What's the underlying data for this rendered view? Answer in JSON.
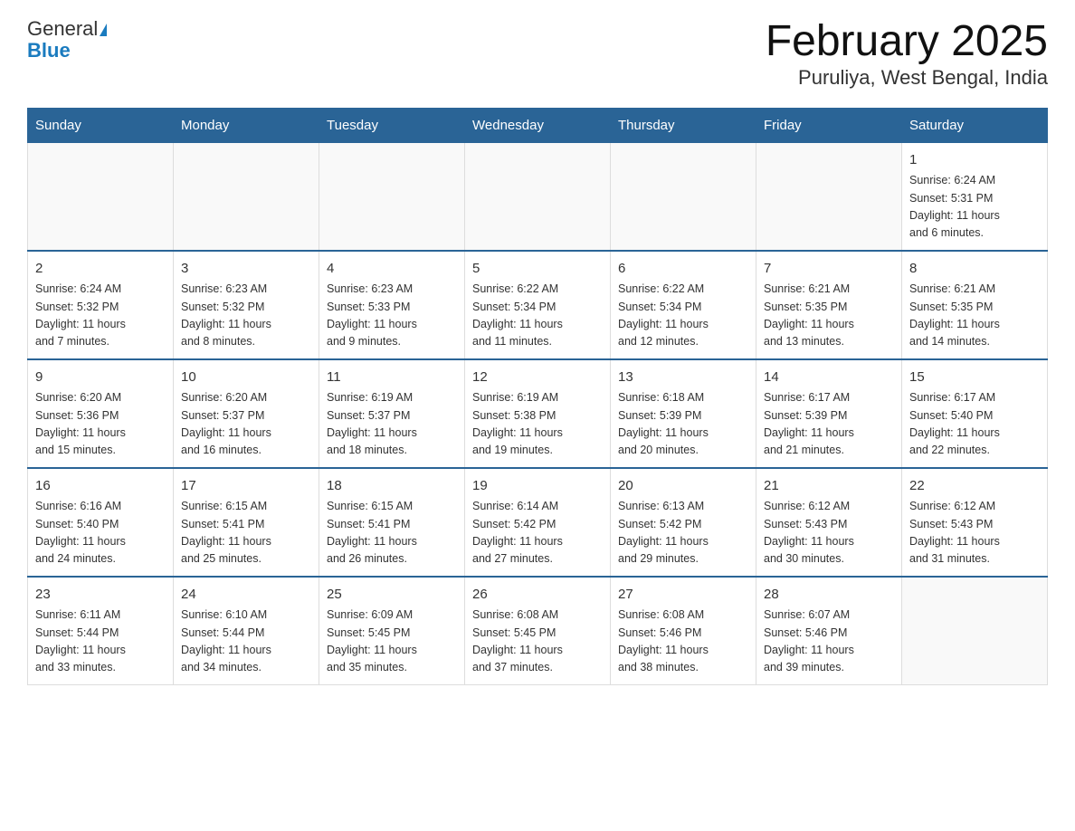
{
  "logo": {
    "general": "General",
    "blue": "Blue",
    "triangle": "▲"
  },
  "header": {
    "month_title": "February 2025",
    "location": "Puruliya, West Bengal, India"
  },
  "days_of_week": [
    "Sunday",
    "Monday",
    "Tuesday",
    "Wednesday",
    "Thursday",
    "Friday",
    "Saturday"
  ],
  "weeks": [
    [
      {
        "day": "",
        "info": ""
      },
      {
        "day": "",
        "info": ""
      },
      {
        "day": "",
        "info": ""
      },
      {
        "day": "",
        "info": ""
      },
      {
        "day": "",
        "info": ""
      },
      {
        "day": "",
        "info": ""
      },
      {
        "day": "1",
        "info": "Sunrise: 6:24 AM\nSunset: 5:31 PM\nDaylight: 11 hours\nand 6 minutes."
      }
    ],
    [
      {
        "day": "2",
        "info": "Sunrise: 6:24 AM\nSunset: 5:32 PM\nDaylight: 11 hours\nand 7 minutes."
      },
      {
        "day": "3",
        "info": "Sunrise: 6:23 AM\nSunset: 5:32 PM\nDaylight: 11 hours\nand 8 minutes."
      },
      {
        "day": "4",
        "info": "Sunrise: 6:23 AM\nSunset: 5:33 PM\nDaylight: 11 hours\nand 9 minutes."
      },
      {
        "day": "5",
        "info": "Sunrise: 6:22 AM\nSunset: 5:34 PM\nDaylight: 11 hours\nand 11 minutes."
      },
      {
        "day": "6",
        "info": "Sunrise: 6:22 AM\nSunset: 5:34 PM\nDaylight: 11 hours\nand 12 minutes."
      },
      {
        "day": "7",
        "info": "Sunrise: 6:21 AM\nSunset: 5:35 PM\nDaylight: 11 hours\nand 13 minutes."
      },
      {
        "day": "8",
        "info": "Sunrise: 6:21 AM\nSunset: 5:35 PM\nDaylight: 11 hours\nand 14 minutes."
      }
    ],
    [
      {
        "day": "9",
        "info": "Sunrise: 6:20 AM\nSunset: 5:36 PM\nDaylight: 11 hours\nand 15 minutes."
      },
      {
        "day": "10",
        "info": "Sunrise: 6:20 AM\nSunset: 5:37 PM\nDaylight: 11 hours\nand 16 minutes."
      },
      {
        "day": "11",
        "info": "Sunrise: 6:19 AM\nSunset: 5:37 PM\nDaylight: 11 hours\nand 18 minutes."
      },
      {
        "day": "12",
        "info": "Sunrise: 6:19 AM\nSunset: 5:38 PM\nDaylight: 11 hours\nand 19 minutes."
      },
      {
        "day": "13",
        "info": "Sunrise: 6:18 AM\nSunset: 5:39 PM\nDaylight: 11 hours\nand 20 minutes."
      },
      {
        "day": "14",
        "info": "Sunrise: 6:17 AM\nSunset: 5:39 PM\nDaylight: 11 hours\nand 21 minutes."
      },
      {
        "day": "15",
        "info": "Sunrise: 6:17 AM\nSunset: 5:40 PM\nDaylight: 11 hours\nand 22 minutes."
      }
    ],
    [
      {
        "day": "16",
        "info": "Sunrise: 6:16 AM\nSunset: 5:40 PM\nDaylight: 11 hours\nand 24 minutes."
      },
      {
        "day": "17",
        "info": "Sunrise: 6:15 AM\nSunset: 5:41 PM\nDaylight: 11 hours\nand 25 minutes."
      },
      {
        "day": "18",
        "info": "Sunrise: 6:15 AM\nSunset: 5:41 PM\nDaylight: 11 hours\nand 26 minutes."
      },
      {
        "day": "19",
        "info": "Sunrise: 6:14 AM\nSunset: 5:42 PM\nDaylight: 11 hours\nand 27 minutes."
      },
      {
        "day": "20",
        "info": "Sunrise: 6:13 AM\nSunset: 5:42 PM\nDaylight: 11 hours\nand 29 minutes."
      },
      {
        "day": "21",
        "info": "Sunrise: 6:12 AM\nSunset: 5:43 PM\nDaylight: 11 hours\nand 30 minutes."
      },
      {
        "day": "22",
        "info": "Sunrise: 6:12 AM\nSunset: 5:43 PM\nDaylight: 11 hours\nand 31 minutes."
      }
    ],
    [
      {
        "day": "23",
        "info": "Sunrise: 6:11 AM\nSunset: 5:44 PM\nDaylight: 11 hours\nand 33 minutes."
      },
      {
        "day": "24",
        "info": "Sunrise: 6:10 AM\nSunset: 5:44 PM\nDaylight: 11 hours\nand 34 minutes."
      },
      {
        "day": "25",
        "info": "Sunrise: 6:09 AM\nSunset: 5:45 PM\nDaylight: 11 hours\nand 35 minutes."
      },
      {
        "day": "26",
        "info": "Sunrise: 6:08 AM\nSunset: 5:45 PM\nDaylight: 11 hours\nand 37 minutes."
      },
      {
        "day": "27",
        "info": "Sunrise: 6:08 AM\nSunset: 5:46 PM\nDaylight: 11 hours\nand 38 minutes."
      },
      {
        "day": "28",
        "info": "Sunrise: 6:07 AM\nSunset: 5:46 PM\nDaylight: 11 hours\nand 39 minutes."
      },
      {
        "day": "",
        "info": ""
      }
    ]
  ]
}
